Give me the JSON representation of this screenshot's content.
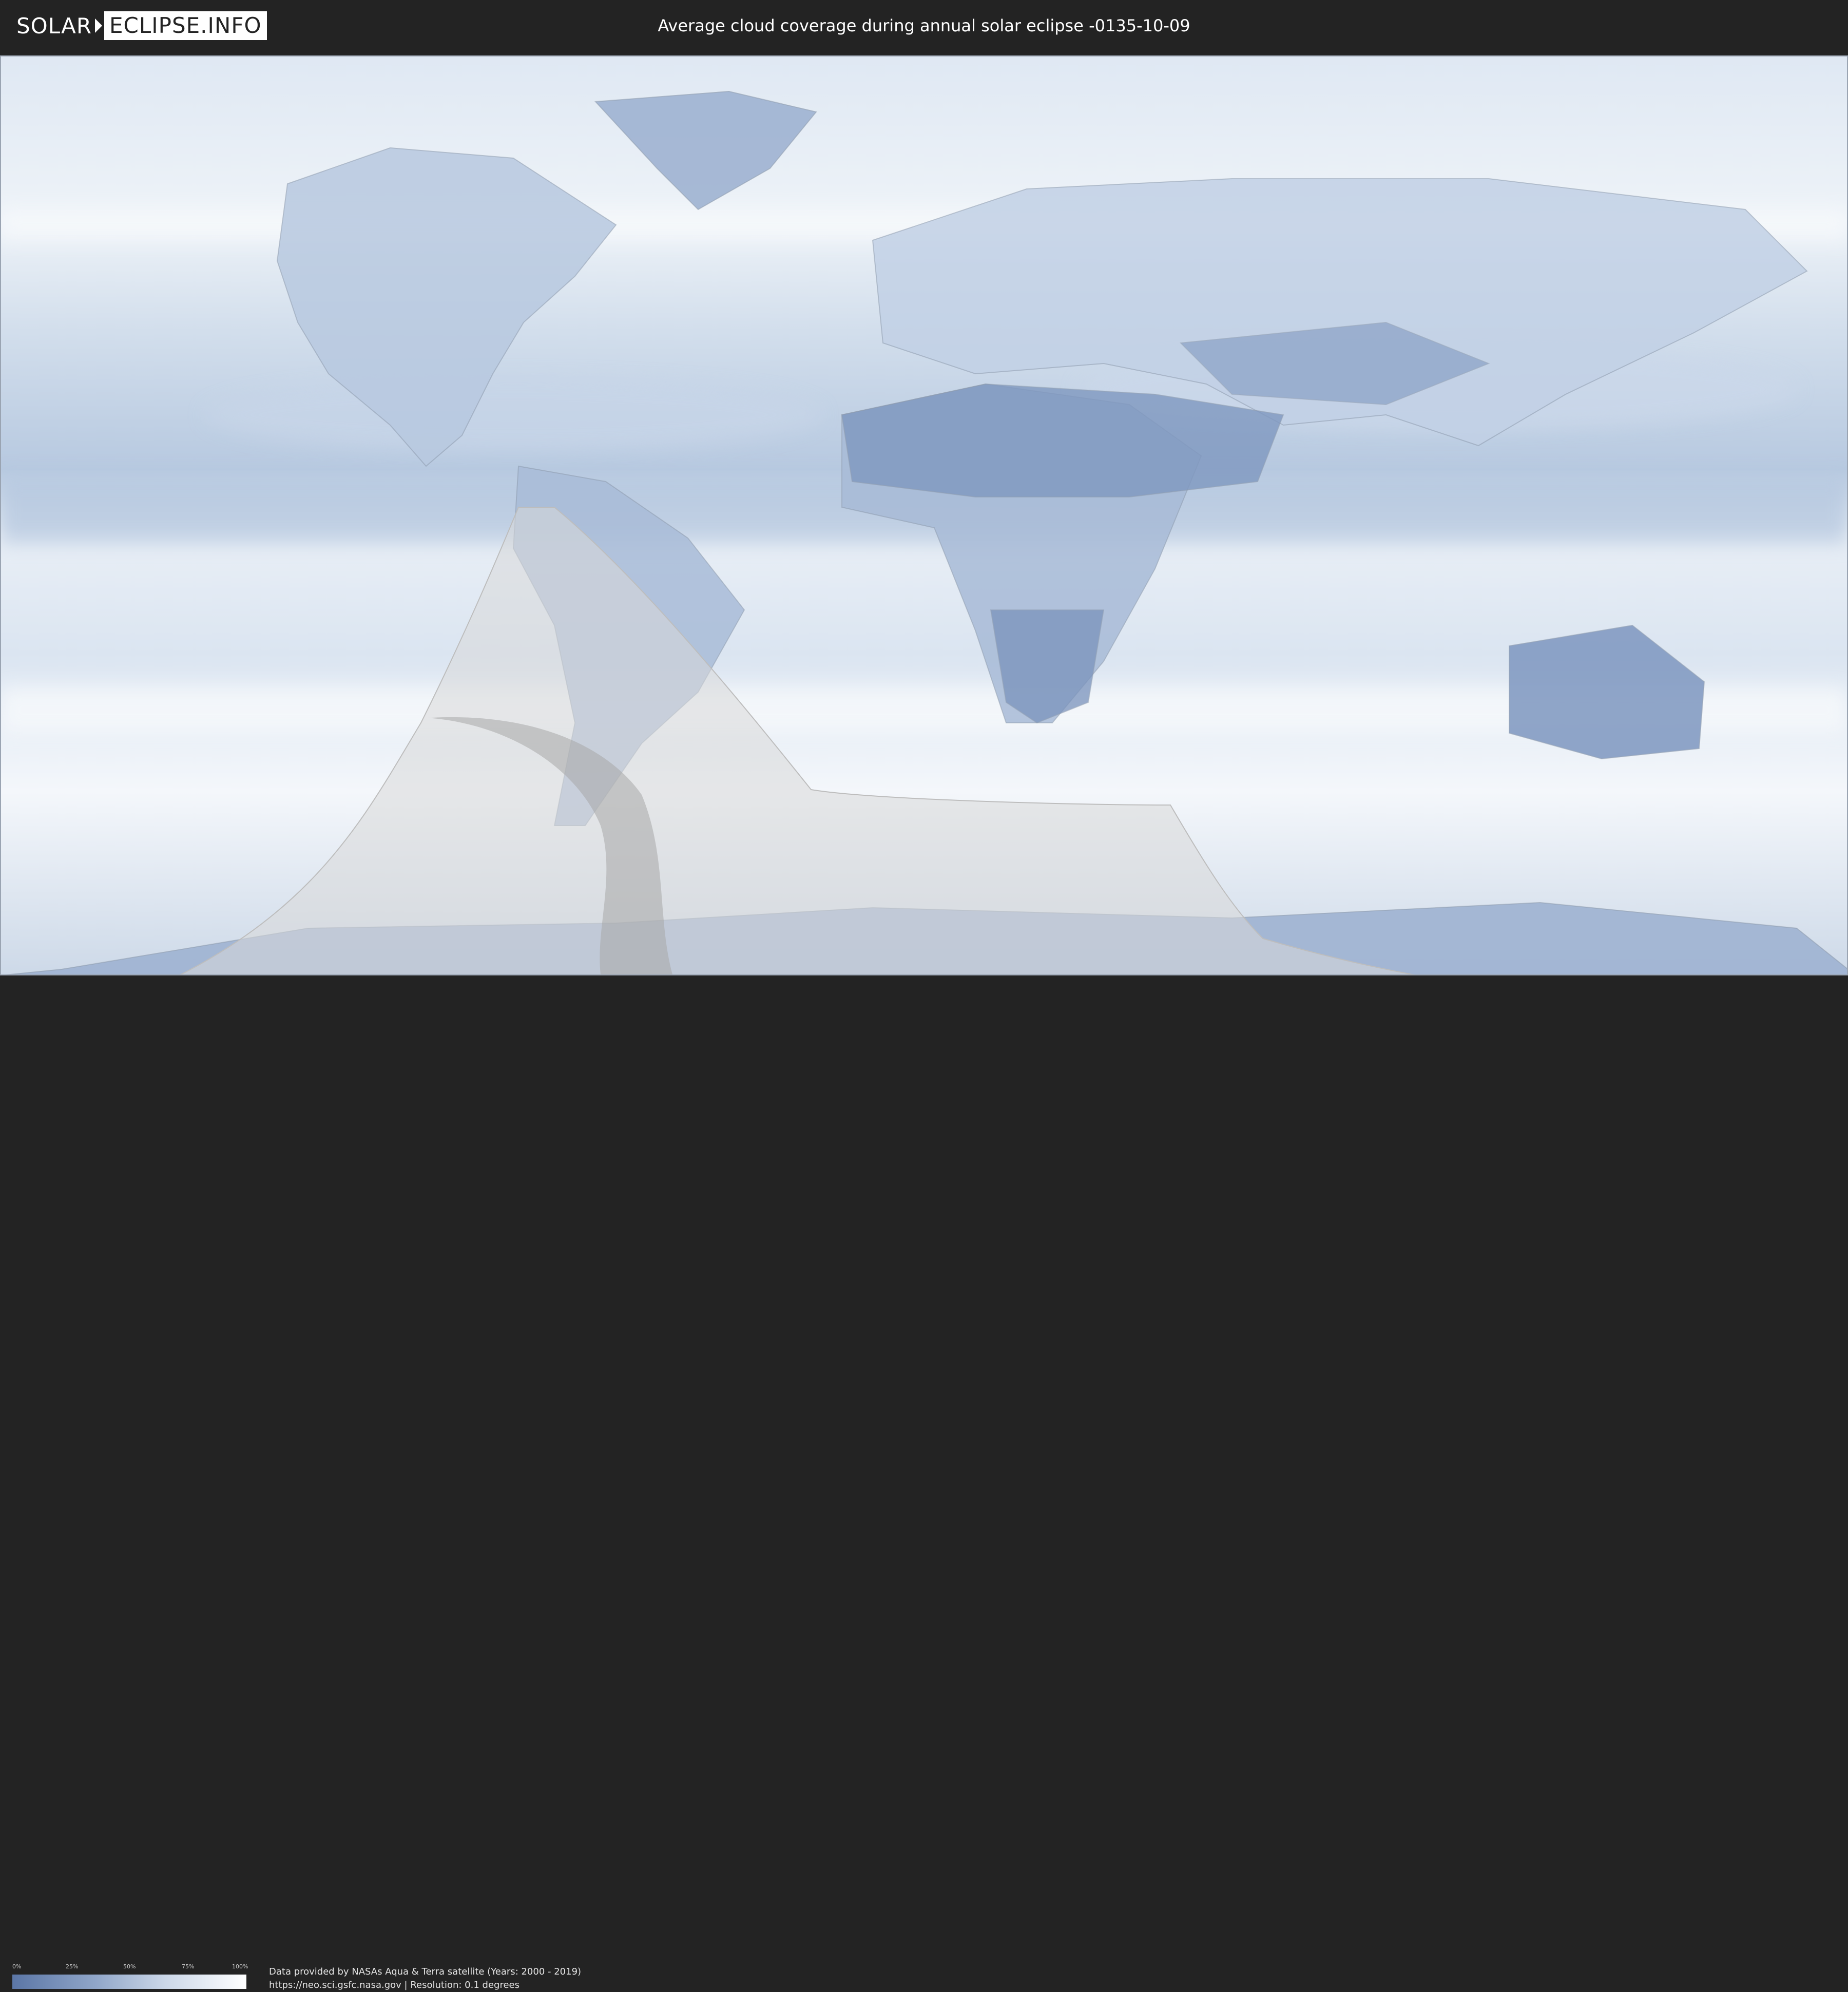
{
  "logo": {
    "part1": "SOLAR",
    "part2": "ECLIPSE.INFO"
  },
  "title": "Average cloud coverage during annual solar eclipse -0135-10-09",
  "legend": {
    "ticks": [
      "0%",
      "25%",
      "50%",
      "75%",
      "100%"
    ]
  },
  "credit": {
    "line1": "Data provided by NASAs Aqua & Terra satellite (Years: 2000 - 2019)",
    "line2": "https://neo.sci.gsfc.nasa.gov | Resolution: 0.1 degrees"
  },
  "colors": {
    "bar": "#232323",
    "cloud_low": "#5b76a6",
    "cloud_high": "#ffffff",
    "overlay": "#d6d6d6"
  },
  "icons": [
    "logo-arrow-icon"
  ]
}
